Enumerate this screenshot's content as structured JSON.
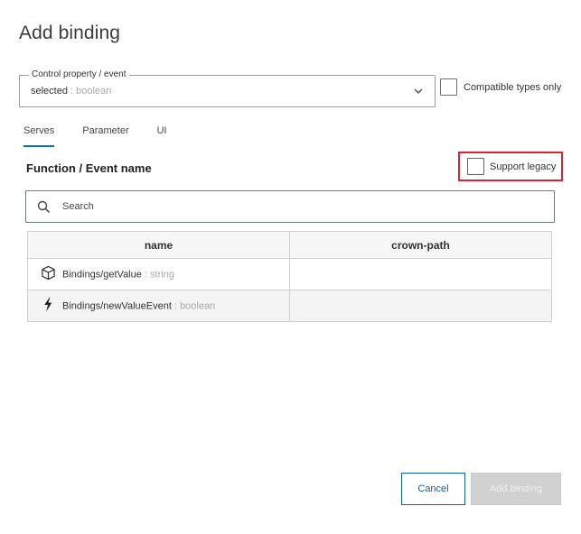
{
  "dialog": {
    "title": "Add binding"
  },
  "control_property": {
    "legend": "Control property / event",
    "value": "selected",
    "value_type": ": boolean"
  },
  "compatible_types": {
    "label": "Compatible types only",
    "checked": false
  },
  "tabs": [
    {
      "label": "Serves",
      "active": true
    },
    {
      "label": "Parameter",
      "active": false
    },
    {
      "label": "UI",
      "active": false
    }
  ],
  "section": {
    "title": "Function / Event name"
  },
  "support_legacy": {
    "label": "Support legacy",
    "checked": false
  },
  "search": {
    "placeholder": "Search"
  },
  "table": {
    "columns": [
      "name",
      "crown-path"
    ],
    "rows": [
      {
        "icon": "cube-icon",
        "name": "Bindings/getValue",
        "type": ": string",
        "crown_path": ""
      },
      {
        "icon": "lightning-icon",
        "name": "Bindings/newValueEvent",
        "type": ": boolean",
        "crown_path": ""
      }
    ]
  },
  "buttons": {
    "cancel": "Cancel",
    "add": "Add binding"
  },
  "colors": {
    "accent": "#0b72b9",
    "highlight_border": "#d9262e",
    "disabled_button": "#d1d1d1"
  }
}
